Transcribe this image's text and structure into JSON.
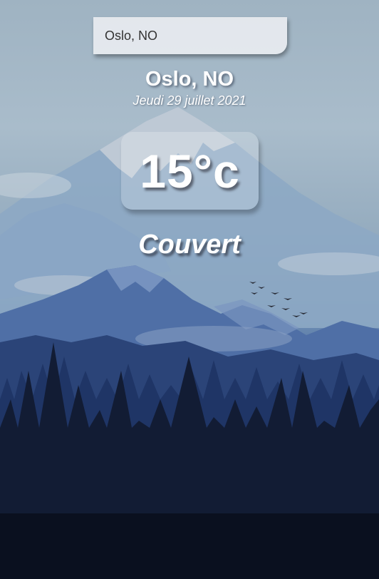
{
  "search": {
    "value": "Oslo, NO",
    "placeholder": ""
  },
  "weather": {
    "location": "Oslo, NO",
    "date": "Jeudi 29 juillet 2021",
    "temperature": "15°c",
    "condition": "Couvert"
  },
  "colors": {
    "text": "#ffffff",
    "search_bg": "#e8ecf0"
  }
}
